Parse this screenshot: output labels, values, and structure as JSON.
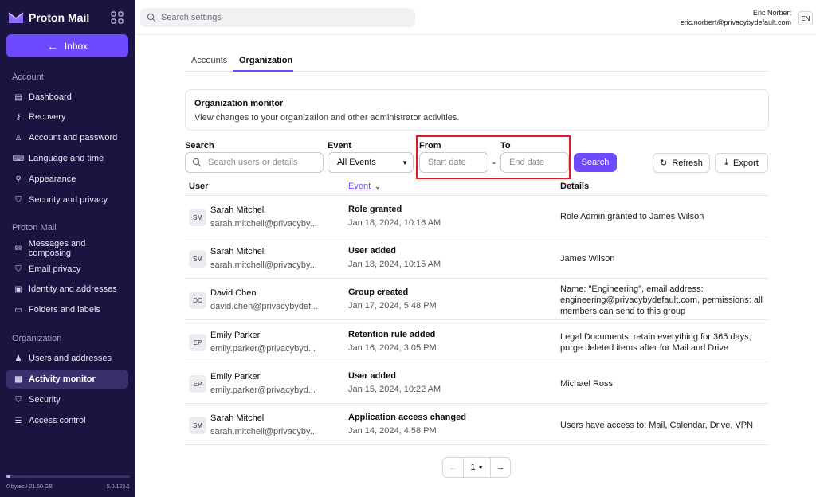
{
  "app": {
    "brand": "Proton Mail",
    "accent": "#6d4aff",
    "sidebar_bg": "#1b1340"
  },
  "sidebar": {
    "inbox_label": "Inbox",
    "sections": [
      {
        "title": "Account",
        "items": [
          {
            "label": "Dashboard",
            "icon": "dashboard-icon"
          },
          {
            "label": "Recovery",
            "icon": "key-icon"
          },
          {
            "label": "Account and password",
            "icon": "user-icon"
          },
          {
            "label": "Language and time",
            "icon": "keyboard-icon"
          },
          {
            "label": "Appearance",
            "icon": "paint-roller-icon"
          },
          {
            "label": "Security and privacy",
            "icon": "shield-icon"
          }
        ]
      },
      {
        "title": "Proton Mail",
        "items": [
          {
            "label": "Messages and composing",
            "icon": "envelope-icon"
          },
          {
            "label": "Email privacy",
            "icon": "shield-icon"
          },
          {
            "label": "Identity and addresses",
            "icon": "id-card-icon"
          },
          {
            "label": "Folders and labels",
            "icon": "folder-icon"
          }
        ]
      },
      {
        "title": "Organization",
        "items": [
          {
            "label": "Users and addresses",
            "icon": "users-icon"
          },
          {
            "label": "Activity monitor",
            "icon": "activity-icon",
            "active": true
          },
          {
            "label": "Security",
            "icon": "shield-icon"
          },
          {
            "label": "Access control",
            "icon": "sliders-icon"
          }
        ]
      }
    ],
    "storage_text": "0 bytes / 21.50 GB",
    "storage_used_fraction": 0.03,
    "version": "5.0.123.1"
  },
  "topbar": {
    "search_placeholder": "Search settings",
    "user_name": "Eric Norbert",
    "user_email": "eric.norbert@privacybydefault.com",
    "language": "EN"
  },
  "tabs": [
    {
      "label": "Accounts"
    },
    {
      "label": "Organization",
      "active": true
    }
  ],
  "monitor": {
    "title": "Organization monitor",
    "description": "View changes to your organization and other administrator activities."
  },
  "filters": {
    "search_label": "Search",
    "search_placeholder": "Search users or details",
    "event_label": "Event",
    "event_value": "All Events",
    "from_label": "From",
    "from_placeholder": "Start date",
    "to_label": "To",
    "to_placeholder": "End date",
    "search_button": "Search",
    "refresh_button": "Refresh",
    "export_button": "Export"
  },
  "table": {
    "headers": {
      "user": "User",
      "event": "Event",
      "details": "Details"
    },
    "rows": [
      {
        "initials": "SM",
        "name": "Sarah Mitchell",
        "email": "sarah.mitchell@privacyby...",
        "event": "Role granted",
        "time": "Jan 18, 2024, 10:16 AM",
        "details": "Role Admin granted to James Wilson"
      },
      {
        "initials": "SM",
        "name": "Sarah Mitchell",
        "email": "sarah.mitchell@privacyby...",
        "event": "User added",
        "time": "Jan 18, 2024, 10:15 AM",
        "details": "James Wilson"
      },
      {
        "initials": "DC",
        "name": "David Chen",
        "email": "david.chen@privacybydef...",
        "event": "Group created",
        "time": "Jan 17, 2024, 5:48 PM",
        "details": "Name: \"Engineering\", email address: engineering@privacybydefault.com, permissions: all members can send to this group"
      },
      {
        "initials": "EP",
        "name": "Emily Parker",
        "email": "emily.parker@privacybyd...",
        "event": "Retention rule added",
        "time": "Jan 16, 2024, 3:05 PM",
        "details": "Legal Documents: retain everything for 365 days; purge deleted items after for Mail and Drive"
      },
      {
        "initials": "EP",
        "name": "Emily Parker",
        "email": "emily.parker@privacybyd...",
        "event": "User added",
        "time": "Jan 15, 2024, 10:22 AM",
        "details": "Michael Ross"
      },
      {
        "initials": "SM",
        "name": "Sarah Mitchell",
        "email": "sarah.mitchell@privacyby...",
        "event": "Application access changed",
        "time": "Jan 14, 2024, 4:58 PM",
        "details": "Users have access to: Mail, Calendar, Drive, VPN"
      }
    ]
  },
  "pagination": {
    "page": "1"
  }
}
